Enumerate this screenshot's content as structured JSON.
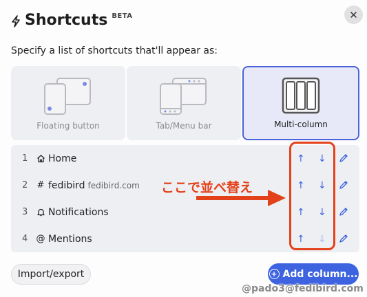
{
  "header": {
    "title": "Shortcuts",
    "badge": "BETA",
    "icon": "bolt-icon"
  },
  "close_icon": "✕",
  "description": "Specify a list of shortcuts that'll appear as:",
  "options": [
    {
      "label": "Floating button",
      "selected": false
    },
    {
      "label": "Tab/Menu bar",
      "selected": false
    },
    {
      "label": "Multi-column",
      "selected": true
    }
  ],
  "shortcuts": [
    {
      "index": "1",
      "icon": "home-icon",
      "label": "Home",
      "sub": "",
      "up": "↑",
      "down": "↓"
    },
    {
      "index": "2",
      "icon": "hash-icon",
      "label": "fedibird",
      "sub": "fedibird.com",
      "up": "↑",
      "down": "↓"
    },
    {
      "index": "3",
      "icon": "bell-icon",
      "label": "Notifications",
      "sub": "",
      "up": "↑",
      "down": "↓"
    },
    {
      "index": "4",
      "icon": "at-icon",
      "label": "Mentions",
      "sub": "",
      "up": "↑",
      "down": "↓"
    }
  ],
  "glyphs": {
    "hash": "#",
    "at": "@",
    "plus": "+"
  },
  "annotation": {
    "text": "ここで並べ替え",
    "color": "#e3411a"
  },
  "buttons": {
    "import_export": "Import/export",
    "add_column": "Add column..."
  },
  "watermark": "@pado3@fedibird.com",
  "colors": {
    "accent": "#3d63e0",
    "annotation": "#e3411a"
  }
}
